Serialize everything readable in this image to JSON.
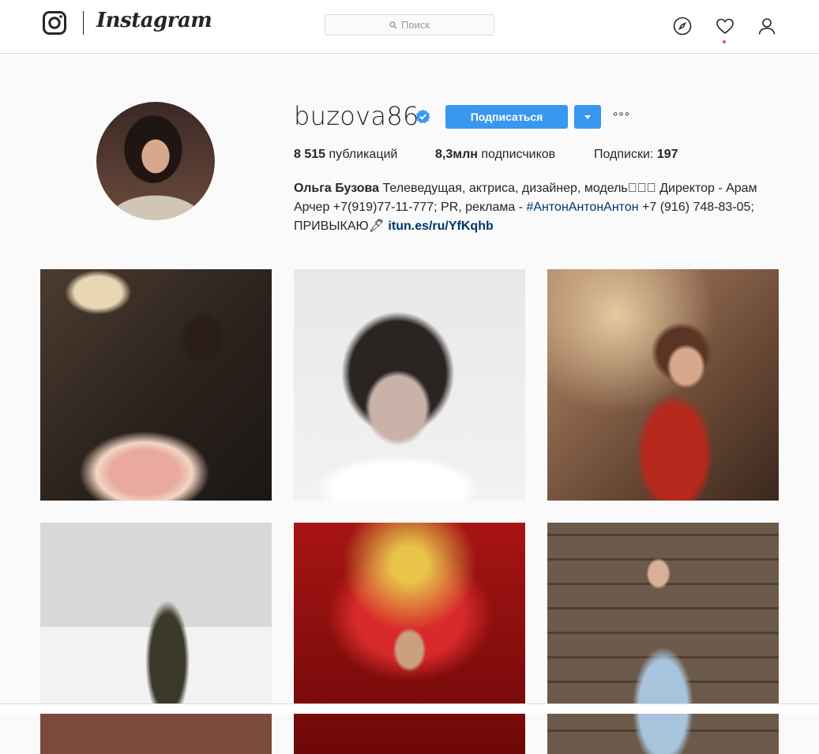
{
  "brand": {
    "wordmark": "Instagram"
  },
  "search": {
    "placeholder": "Поиск"
  },
  "nav": {
    "icons": [
      "explore-icon",
      "heart-icon",
      "profile-icon"
    ]
  },
  "profile": {
    "username": "buzova86",
    "verified": true,
    "follow_label": "Подписаться",
    "more_label": "°°°",
    "stats": {
      "posts_count": "8 515",
      "posts_label": "публикаций",
      "followers_count": "8,3млн",
      "followers_label": "подписчиков",
      "following_label": "Подписки:",
      "following_count": "197"
    },
    "bio": {
      "name": "Ольга Бузова",
      "text1": "Телеведущая, актриса, дизайнер, модель⃣⃣⃣ Директор - Арам Арчер +7(919)77-11-777; PR, реклама - ",
      "hashtag": "#АнтонАнтонАнтон",
      "text2": " +7 (916) 748-83-05; ПРИВЫКАЮ🖋 ",
      "link": "itun.es/ru/YfKqhb"
    }
  },
  "colors": {
    "accent": "#3897f0",
    "link": "#003569",
    "notify_dot": "#ed4956"
  },
  "posts": [
    "post-1",
    "post-2",
    "post-3",
    "post-4",
    "post-5",
    "post-6"
  ]
}
